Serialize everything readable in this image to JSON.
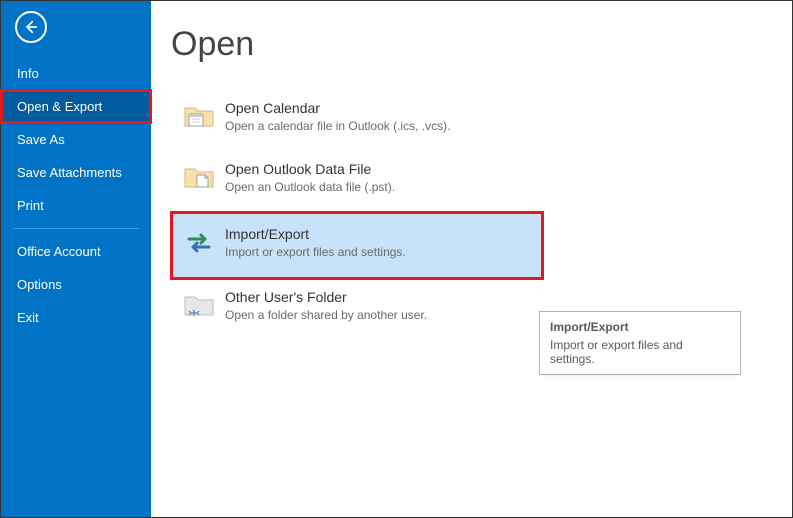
{
  "sidebar": {
    "items": [
      {
        "label": "Info"
      },
      {
        "label": "Open & Export"
      },
      {
        "label": "Save As"
      },
      {
        "label": "Save Attachments"
      },
      {
        "label": "Print"
      },
      {
        "label": "Office Account"
      },
      {
        "label": "Options"
      },
      {
        "label": "Exit"
      }
    ]
  },
  "main": {
    "title": "Open",
    "options": [
      {
        "title": "Open Calendar",
        "desc": "Open a calendar file in Outlook (.ics, .vcs)."
      },
      {
        "title": "Open Outlook Data File",
        "desc": "Open an Outlook data file (.pst)."
      },
      {
        "title": "Import/Export",
        "desc": "Import or export files and settings."
      },
      {
        "title": "Other User's Folder",
        "desc": "Open a folder shared by another user."
      }
    ]
  },
  "tooltip": {
    "title": "Import/Export",
    "desc": "Import or export files and settings."
  }
}
